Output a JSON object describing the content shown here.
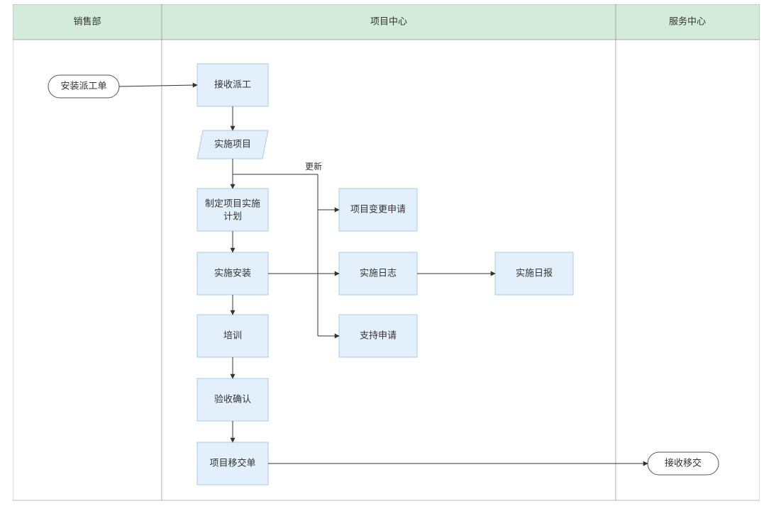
{
  "lanes": {
    "sales": {
      "header": "销售部"
    },
    "project": {
      "header": "项目中心"
    },
    "service": {
      "header": "服务中心"
    }
  },
  "nodes": {
    "dispatch_order": "安装派工单",
    "receive_dispatch": "接收派工",
    "impl_project": "实施项目",
    "make_plan_l1": "制定项目实施",
    "make_plan_l2": "计划",
    "install": "实施安装",
    "training": "培训",
    "accept_confirm": "验收确认",
    "handover": "项目移交单",
    "change_request": "项目变更申请",
    "impl_log": "实施日志",
    "support_request": "支持申请",
    "daily_report": "实施日报",
    "receive_handover": "接收移交"
  },
  "labels": {
    "update": "更新"
  }
}
